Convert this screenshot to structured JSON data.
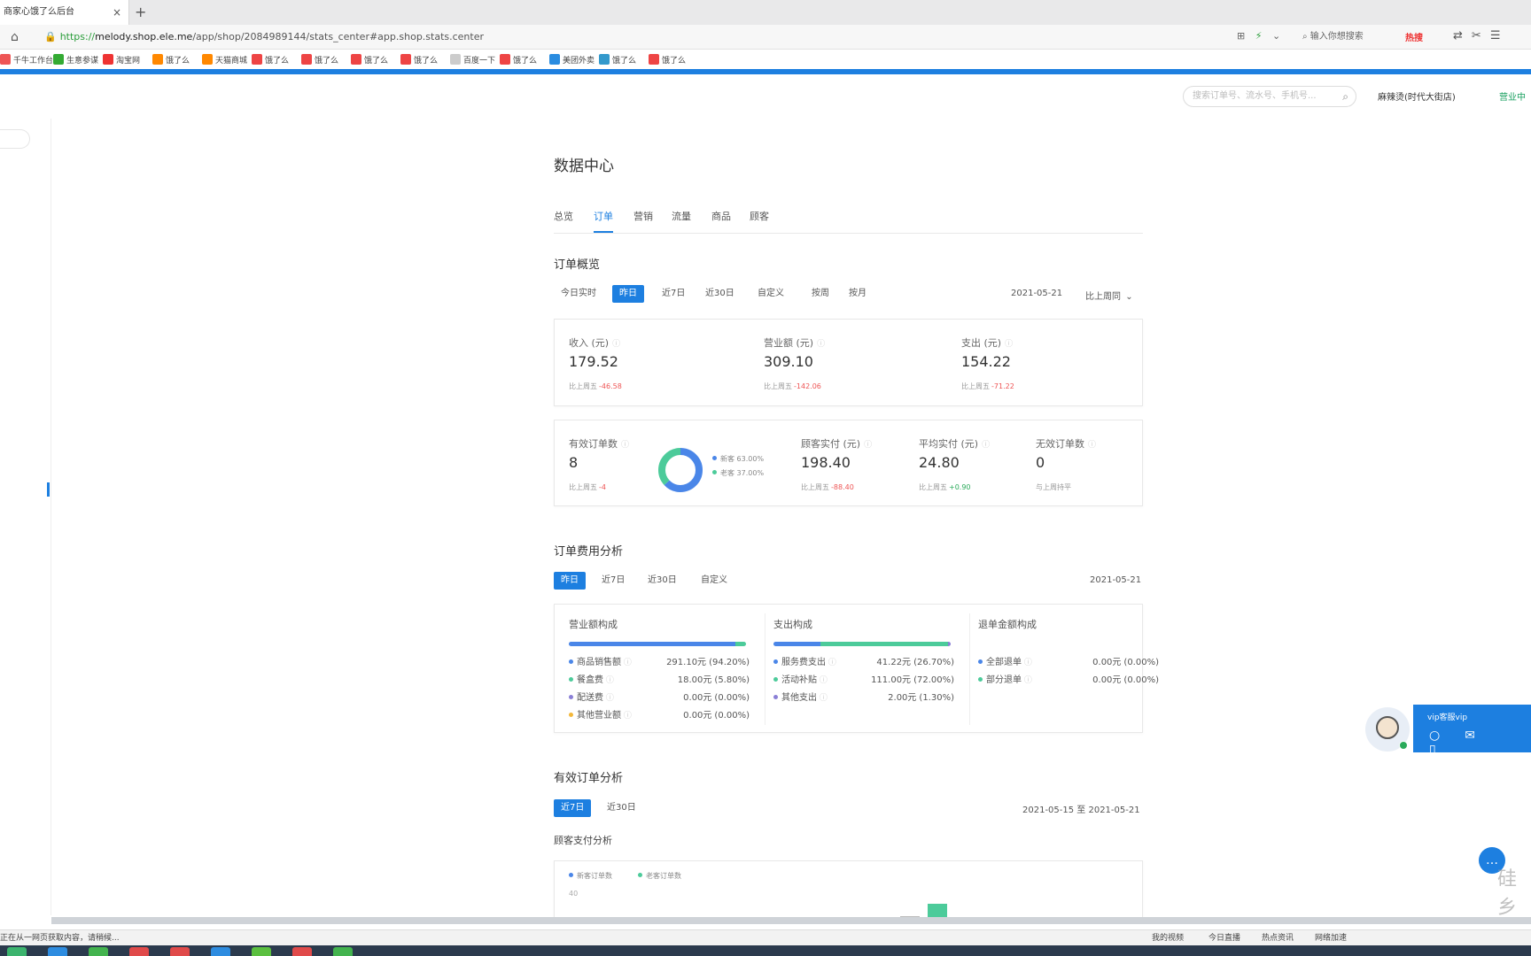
{
  "browser": {
    "tab_title": "商家心饿了么后台",
    "tab_close": "×",
    "new_tab": "+",
    "url_scheme": "https://",
    "url_domain": "melody.shop.ele.me",
    "url_path": "/app/shop/2084989144/stats_center#app.shop.stats.center",
    "search_engine_placeholder": "输入你想搜索",
    "hot_search": "热搜",
    "bookmarks": [
      "千牛工作台",
      "生意参谋",
      "淘宝网",
      "饿了么",
      "天猫商城",
      "饿了么",
      "饿了么",
      "饿了么",
      "饿了么",
      "百度一下",
      "饿了么",
      "美团外卖",
      "饿了么",
      "饿了么"
    ]
  },
  "header": {
    "search_placeholder": "搜索订单号、流水号、手机号...",
    "store_name": "麻辣烫(时代大街店)",
    "store_status": "营业中"
  },
  "page": {
    "title": "数据中心",
    "tabs": [
      "总览",
      "订单",
      "营销",
      "流量",
      "商品",
      "顾客"
    ],
    "active_tab": 1
  },
  "overview": {
    "title": "订单概览",
    "ranges": [
      "今日实时",
      "昨日",
      "近7日",
      "近30日",
      "自定义",
      "按周",
      "按月"
    ],
    "active_range": 1,
    "date": "2021-05-21",
    "compare": "比上周同",
    "compare_icon": "chevron-down",
    "row1": [
      {
        "label": "收入 (元)",
        "value": "179.52",
        "sub": "比上周五",
        "delta": "-46.58",
        "dir": "down"
      },
      {
        "label": "营业额 (元)",
        "value": "309.10",
        "sub": "比上周五",
        "delta": "-142.06",
        "dir": "down"
      },
      {
        "label": "支出 (元)",
        "value": "154.22",
        "sub": "比上周五",
        "delta": "-71.22",
        "dir": "down"
      }
    ],
    "row2": [
      {
        "label": "有效订单数",
        "value": "8",
        "sub": "比上周五",
        "delta": "-4",
        "dir": "down"
      },
      {
        "label": "顾客实付 (元)",
        "value": "198.40",
        "sub": "比上周五",
        "delta": "-88.40",
        "dir": "down"
      },
      {
        "label": "平均实付 (元)",
        "value": "24.80",
        "sub": "比上周五",
        "delta": "+0.90",
        "dir": "up"
      },
      {
        "label": "无效订单数",
        "value": "0",
        "sub": "与上周持平",
        "delta": "",
        "dir": "flat"
      }
    ],
    "donut": {
      "new_label": "新客",
      "new_pct": "63.00%",
      "old_label": "老客",
      "old_pct": "37.00%",
      "new_share": 0.63,
      "old_share": 0.37
    }
  },
  "colors": {
    "blue": "#4a86e8",
    "green": "#4ccb9a",
    "accent": "#1d7fe0",
    "gold": "#f3b83a"
  },
  "cost": {
    "title": "订单费用分析",
    "ranges": [
      "昨日",
      "近7日",
      "近30日",
      "自定义"
    ],
    "active_range": 0,
    "date": "2021-05-21",
    "columns": [
      {
        "title": "营业额构成",
        "rows": [
          {
            "label": "商品销售额",
            "value": "291.10元",
            "pct": "(94.20%)",
            "color": "#4a86e8",
            "share": 0.942
          },
          {
            "label": "餐盒费",
            "value": "18.00元",
            "pct": "(5.80%)",
            "color": "#4ccb9a",
            "share": 0.058
          },
          {
            "label": "配送费",
            "value": "0.00元",
            "pct": "(0.00%)",
            "color": "#8a7fd6",
            "share": 0
          },
          {
            "label": "其他营业额",
            "value": "0.00元",
            "pct": "(0.00%)",
            "color": "#f3b83a",
            "share": 0
          }
        ]
      },
      {
        "title": "支出构成",
        "rows": [
          {
            "label": "服务费支出",
            "value": "41.22元",
            "pct": "(26.70%)",
            "color": "#4a86e8",
            "share": 0.267
          },
          {
            "label": "活动补贴",
            "value": "111.00元",
            "pct": "(72.00%)",
            "color": "#4ccb9a",
            "share": 0.72
          },
          {
            "label": "其他支出",
            "value": "2.00元",
            "pct": "(1.30%)",
            "color": "#8a7fd6",
            "share": 0.013
          }
        ]
      },
      {
        "title": "退单金额构成",
        "rows": [
          {
            "label": "全部退单",
            "value": "0.00元",
            "pct": "(0.00%)",
            "color": "#4a86e8",
            "share": 0
          },
          {
            "label": "部分退单",
            "value": "0.00元",
            "pct": "(0.00%)",
            "color": "#4ccb9a",
            "share": 0
          }
        ]
      }
    ]
  },
  "valid": {
    "title": "有效订单分析",
    "ranges": [
      "近7日",
      "近30日"
    ],
    "active_range": 0,
    "date": "2021-05-15 至 2021-05-21",
    "subtitle": "顾客支付分析",
    "legend": [
      "新客订单数",
      "老客订单数"
    ],
    "y_tick": "40"
  },
  "widget": {
    "vip_title": "vip客服vip",
    "watermark": "硅乡"
  },
  "status": {
    "left": "正在从一网页获取内容，请稍候...",
    "right": [
      "我的视频",
      "今日直播",
      "热点资讯",
      "网络加速"
    ]
  }
}
